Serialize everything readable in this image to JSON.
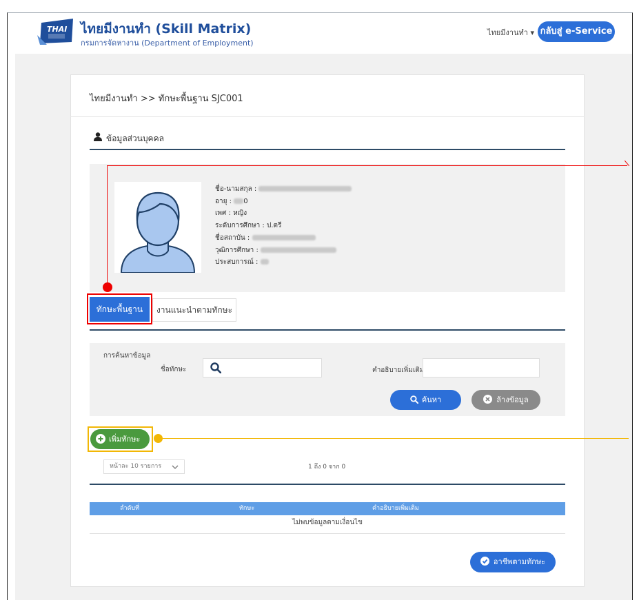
{
  "header": {
    "title": "ไทยมีงานทำ (Skill Matrix)",
    "subtitle": "กรมการจัดหางาน (Department of Employment)",
    "logo_text": "THAI",
    "nav_link": "ไทยมีงานทำ ▾",
    "back_button": "กลับสู่ e-Service"
  },
  "breadcrumb": "ไทยมีงานทำ >> ทักษะพื้นฐาน SJC001",
  "profile": {
    "section_title": "ข้อมูลส่วนบุคคล",
    "fields": {
      "name_label": "ชื่อ-นามสกุล :",
      "age_label": "อายุ :",
      "age_value": "0",
      "gender_label": "เพศ :",
      "gender_value": "หญิง",
      "education_label": "ระดับการศึกษา :",
      "education_value": "ป.ตรี",
      "institute_label": "ชื่อสถาบัน :",
      "degree_label": "วุฒิการศึกษา :",
      "experience_label": "ประสบการณ์ :"
    }
  },
  "tabs": [
    {
      "label": "ทักษะพื้นฐาน",
      "active": true
    },
    {
      "label": "งานแนะนำตามทักษะ",
      "active": false
    }
  ],
  "search": {
    "caption": "การค้นหาข้อมูล",
    "skill_label": "ชื่อทักษะ",
    "skill_value": "",
    "desc_label": "คำอธิบายเพิ่มเติม",
    "desc_value": "",
    "search_button": "ค้นหา",
    "clear_button": "ล้างข้อมูล"
  },
  "add_button": "เพิ่มทักษะ",
  "pagination": {
    "page_size": "หน้าละ 10 รายการ",
    "info": "1 ถึง 0 จาก 0"
  },
  "table": {
    "columns": [
      "ลำดับที่",
      "ทักษะ",
      "คำอธิบายเพิ่มเติม"
    ],
    "empty_message": "ไม่พบข้อมูลตามเงื่อนไข"
  },
  "career_button": "อาชีพตามทักษะ",
  "colors": {
    "primary": "#2c6fd8",
    "success": "#4a9a3e",
    "highlight_red": "#e00000",
    "highlight_yellow": "#f2b705"
  }
}
